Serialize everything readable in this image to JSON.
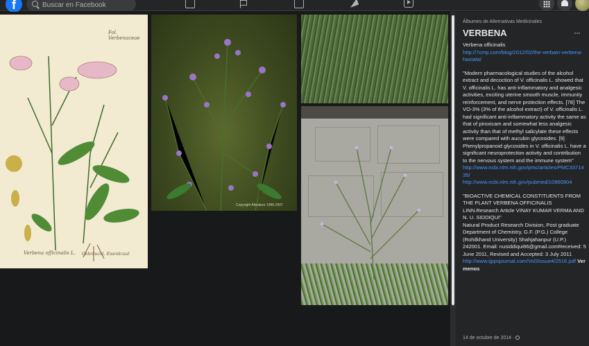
{
  "topbar": {
    "logo_letter": "f",
    "search_placeholder": "Buscar en Facebook",
    "nav_icons": [
      "home-icon",
      "flag-icon",
      "stats-icon",
      "megaphone-icon",
      "video-icon"
    ],
    "right_icons": [
      "menu-grid-icon",
      "bell-icon",
      "avatar"
    ],
    "brand_color": "#1877f2"
  },
  "photos": {
    "illustration_caption_top": "Fol. Verbenaceae",
    "illustration_caption_bottom": "Verbena officinalis L.",
    "illustration_caption_bottom2": "Gebräuchl. Eisenkraut",
    "photo2_watermark": "Copyright Altnature 1996-2007"
  },
  "panel": {
    "album": "Álbumes de Alternativas Medicinales",
    "title": "VERBENA",
    "more_label": "···",
    "p1_title": "Verbena officinalis",
    "p1_link": "http://7cmp.com/blog/2012/02/the-verbain-verbena-hastata/",
    "p2_text": "\"Modern pharmacological studies of the alcohol extract and decoction of V. officinalis L. showed that V. officinalis L. has anti-inflammatory and analgesic activities, exciting uterine smooth muscle, immunity reinforcement, and nerve protection effects. [78] The VO-3% (3% of the alcohol extract) of V. officinalis L. had significant anti-inflammatory activity the same as that of piroxicam and somewhat less analgesic activity than that of methyl salicylate these effects were compared with aucubin glycosides. [9] Phenylpropanoid glycosides in V. officinalis L. have a significant neuroprotection activity and contribution to the nervous system and the immune system\"",
    "p2_link1": "http://www.ncbi.nlm.nih.gov/pmc/articles/PMC3371435/",
    "p2_link2": "http://www.ncbi.nlm.nih.gov/pubmed/10960904",
    "p3_title": "\"BIOACTIVE CHEMICAL CONSTITUENTS FROM THE PLANT VERBENA OFFICINALIS LINN.Research Article VINAY KUMAR VERMA AND N. U. SIDDIQUI\"",
    "p3_text": "Natural Product Research Division, Post graduate Department of Chemistry, G.F. (P.G.) College (Rohilkhand University) Shahjahanpur (U.P.) 242001. Email: nusiddiqui86@gmail.comReceived: 5 June 2011, Revised and Accepted: 3 July 2011",
    "p3_link": "http://www.ijppsjournal.com/Vol3Issue4/2516.pdf",
    "see_more": "Ver menos",
    "date": "14 de octubre de 2014 ·"
  }
}
